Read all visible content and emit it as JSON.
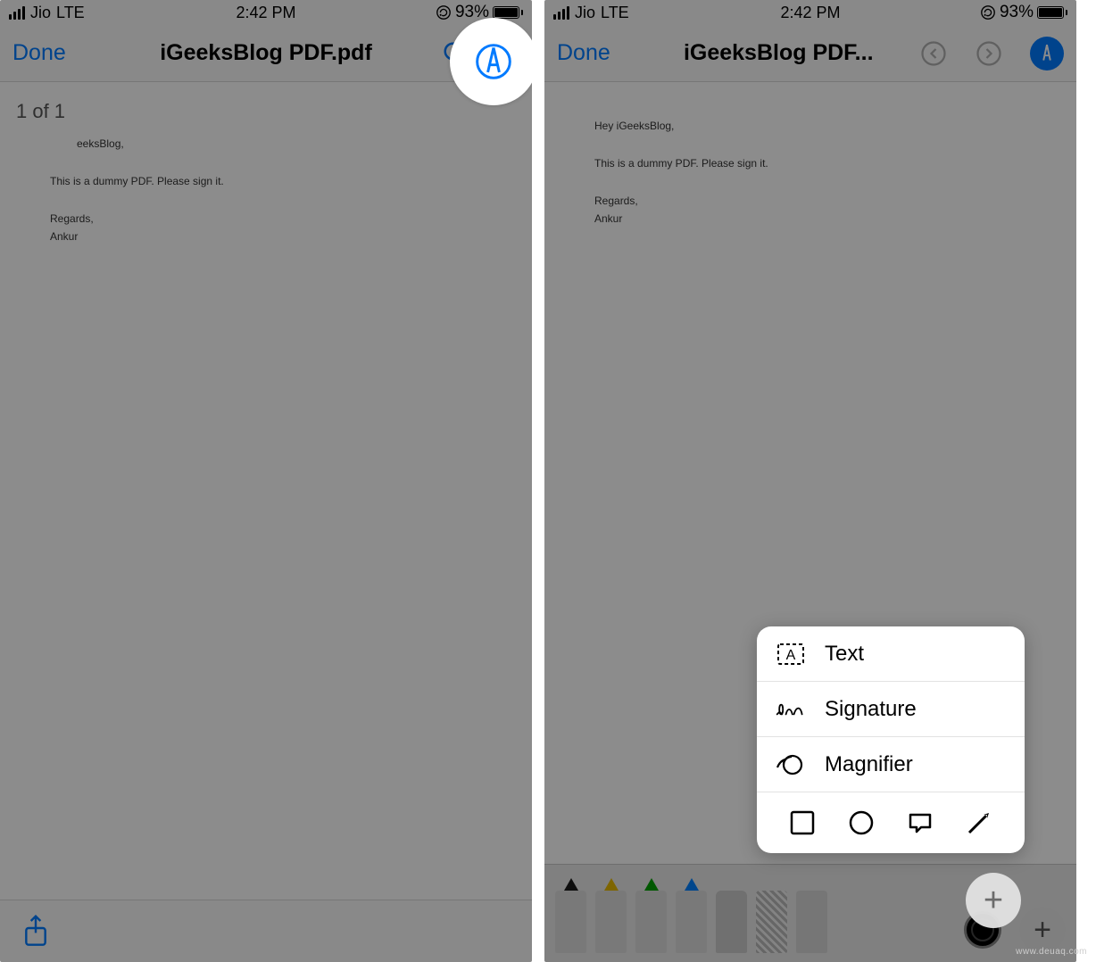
{
  "status": {
    "carrier": "Jio",
    "network": "LTE",
    "time": "2:42 PM",
    "battery_pct": "93%",
    "battery_fill_pct": 93
  },
  "left": {
    "nav": {
      "done": "Done",
      "title": "iGeeksBlog PDF.pdf"
    },
    "page_indicator": "1 of 1",
    "doc": {
      "line1": "eeksBlog,",
      "line2": "This is a dummy PDF. Please sign it.",
      "line3": "Regards,",
      "line4": "Ankur"
    }
  },
  "right": {
    "nav": {
      "done": "Done",
      "title": "iGeeksBlog PDF..."
    },
    "doc": {
      "line1": "Hey iGeeksBlog,",
      "line2": "This is a dummy PDF. Please sign it.",
      "line3": "Regards,",
      "line4": "Ankur"
    },
    "popup": {
      "text": "Text",
      "signature": "Signature",
      "magnifier": "Magnifier"
    },
    "tools": {
      "colors": [
        "#1a1a1a",
        "#e6b800",
        "#00a000",
        "#0080ff",
        "#d00000",
        "#888888"
      ]
    }
  },
  "watermark": "www.deuaq.com"
}
